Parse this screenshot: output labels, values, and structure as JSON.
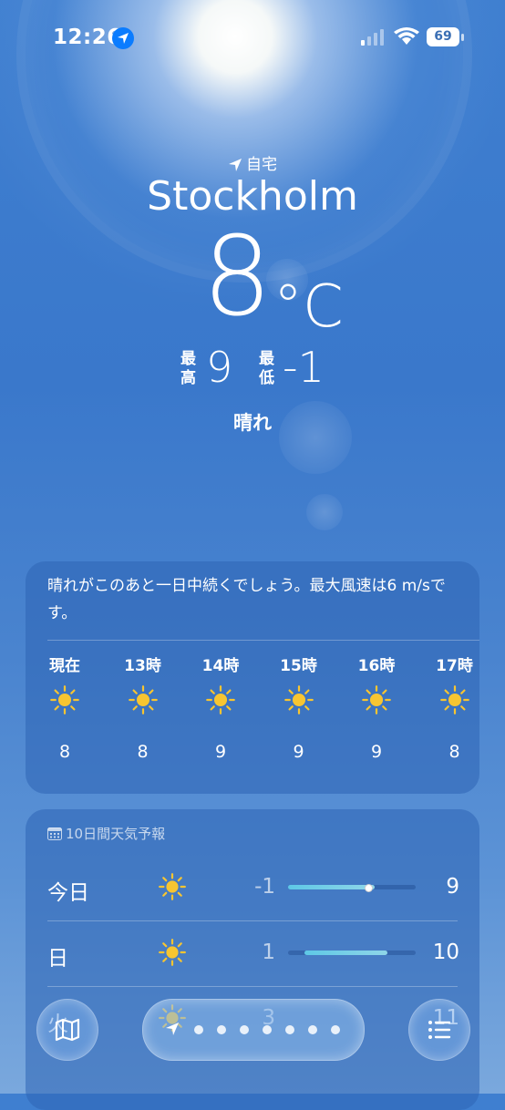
{
  "status_bar": {
    "time": "12:26",
    "battery": "69"
  },
  "header": {
    "location_label": "自宅",
    "city": "Stockholm",
    "temperature": "8",
    "unit": "°C",
    "high_label": "最高",
    "high": "9",
    "low_label": "最低",
    "low": "-1",
    "condition": "晴れ"
  },
  "hourly": {
    "summary": "晴れがこのあと一日中続くでしょう。最大風速は6 m/sです。",
    "items": [
      {
        "time": "現在",
        "icon": "sun-icon",
        "temp": "8"
      },
      {
        "time": "13時",
        "icon": "sun-icon",
        "temp": "8"
      },
      {
        "time": "14時",
        "icon": "sun-icon",
        "temp": "9"
      },
      {
        "time": "15時",
        "icon": "sun-icon",
        "temp": "9"
      },
      {
        "time": "16時",
        "icon": "sun-icon",
        "temp": "9"
      },
      {
        "time": "17時",
        "icon": "sun-icon",
        "temp": "8"
      }
    ]
  },
  "ten_day": {
    "title": "10日間天気予報",
    "days": [
      {
        "day": "今日",
        "icon": "sun-icon",
        "low": "-1",
        "high": "9",
        "range_start": 0.0,
        "range_end": 0.68,
        "current": 0.6
      },
      {
        "day": "日",
        "icon": "sun-icon",
        "low": "1",
        "high": "10",
        "range_start": 0.13,
        "range_end": 0.78
      },
      {
        "day": "火",
        "icon": "sun-icon",
        "low": "3",
        "high": "11"
      }
    ]
  },
  "colors": {
    "sun": "#f7c531",
    "location_blue": "#0a7cff",
    "temp_bar": "#5ec8e6"
  },
  "toolbar": {
    "page_count": 7
  }
}
